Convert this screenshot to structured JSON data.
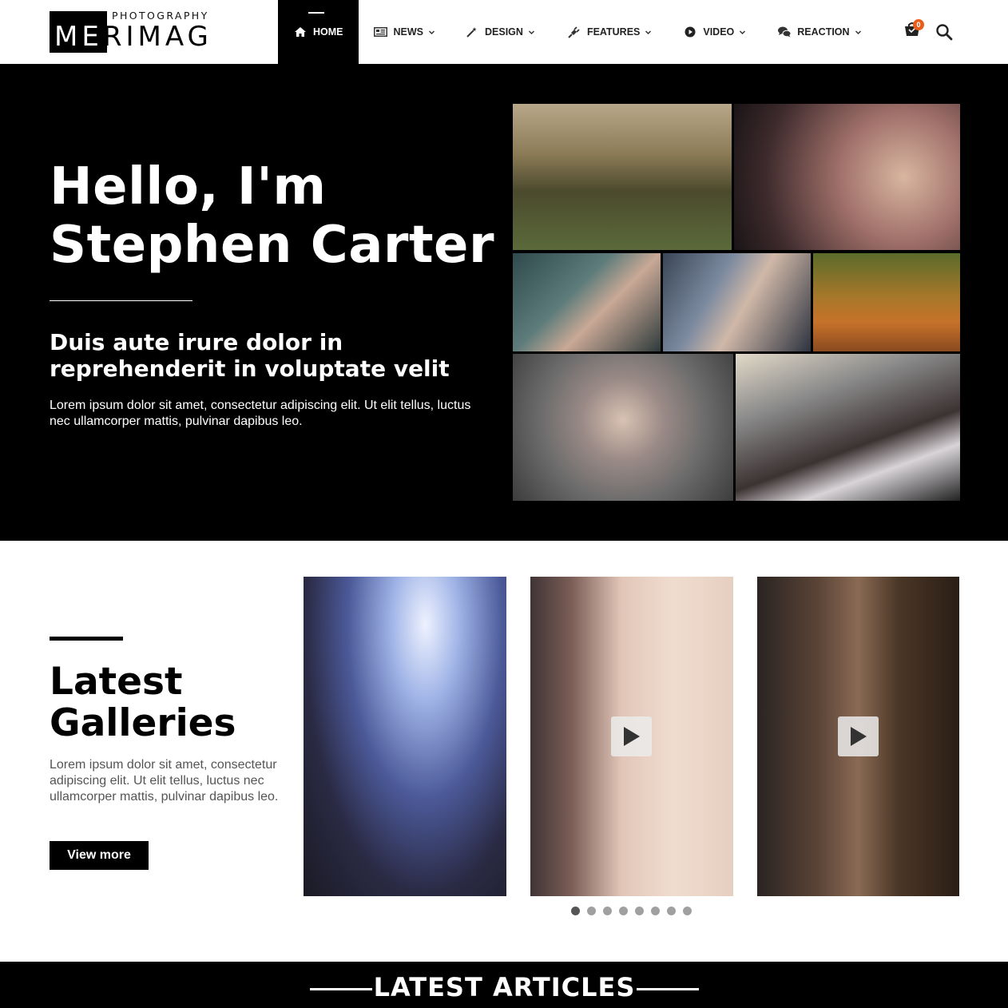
{
  "brand": {
    "subtitle": "PHOTOGRAPHY",
    "name_part1": "ME",
    "name_part2": "RIMAG"
  },
  "nav": {
    "items": [
      {
        "label": "HOME",
        "icon": "home-icon",
        "active": true
      },
      {
        "label": "NEWS",
        "icon": "newspaper-icon"
      },
      {
        "label": "DESIGN",
        "icon": "magic-wand-icon"
      },
      {
        "label": "FEATURES",
        "icon": "plug-icon"
      },
      {
        "label": "VIDEO",
        "icon": "play-circle-icon"
      },
      {
        "label": "REACTION",
        "icon": "chat-icon"
      }
    ],
    "cart_count": "0"
  },
  "hero": {
    "title_line1": "Hello, I'm",
    "title_line2": "Stephen Carter",
    "subtitle": "Duis aute irure dolor in reprehenderit in voluptate velit",
    "text": "Lorem ipsum dolor sit amet, consectetur adipiscing elit. Ut elit tellus, luctus nec ullamcorper mattis, pulvinar dapibus leo."
  },
  "galleries": {
    "title_line1": "Latest",
    "title_line2": "Galleries",
    "text": "Lorem ipsum dolor sit amet, consectetur adipiscing elit. Ut elit tellus, luctus nec ullamcorper mattis, pulvinar dapibus leo.",
    "button": "View more",
    "slide_count": 8,
    "active_slide": 1
  },
  "articles": {
    "heading": "LATEST ARTICLES"
  },
  "colors": {
    "accent": "#000000",
    "badge": "#e85d1a"
  }
}
